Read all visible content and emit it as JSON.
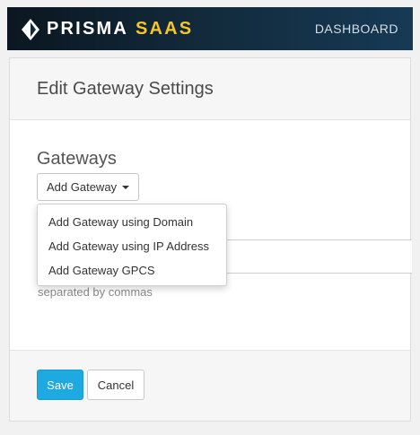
{
  "header": {
    "brand_primary": "PRISMA",
    "brand_secondary": "SAAS",
    "nav_link": "DASHBOARD",
    "logo_icon": "prisma-logo-icon"
  },
  "panel": {
    "title": "Edit Gateway Settings",
    "gateways_heading": "Gateways",
    "add_gateway_label": "Add Gateway",
    "help_text": "separated by commas",
    "field_value": ""
  },
  "dropdown": {
    "items": [
      {
        "label": "Add Gateway using Domain"
      },
      {
        "label": "Add Gateway using IP Address"
      },
      {
        "label": "Add Gateway GPCS"
      }
    ]
  },
  "footer": {
    "save_label": "Save",
    "cancel_label": "Cancel"
  },
  "colors": {
    "accent": "#f5c52a",
    "primary_button": "#1ea9e1",
    "topbar": "#12293a"
  }
}
